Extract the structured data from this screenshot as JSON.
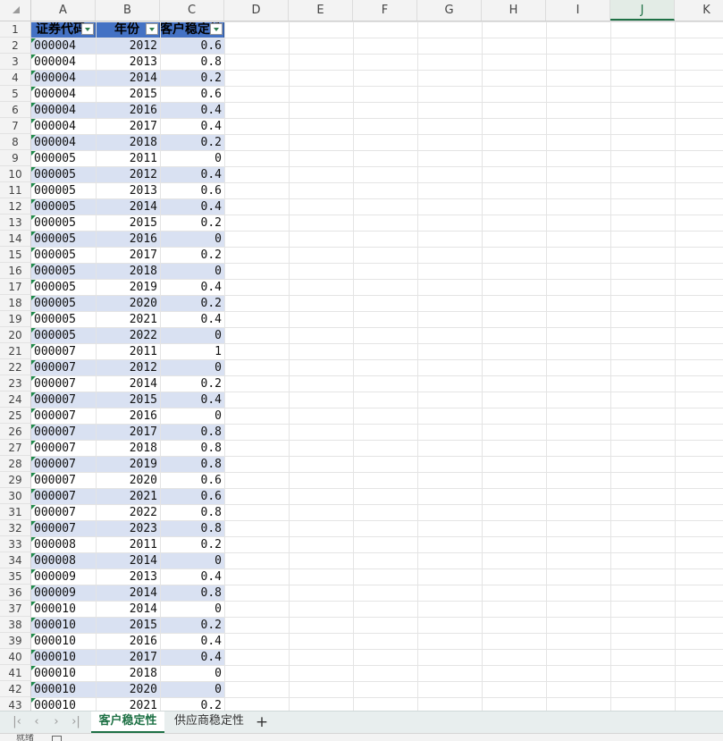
{
  "columns": [
    "A",
    "B",
    "C",
    "D",
    "E",
    "F",
    "G",
    "H",
    "I",
    "J",
    "K"
  ],
  "selected_column": "J",
  "rows": [
    "1",
    "2",
    "3",
    "4",
    "5",
    "6",
    "7",
    "8",
    "9",
    "10",
    "11",
    "12",
    "13",
    "14",
    "15",
    "16",
    "17",
    "18",
    "19",
    "20",
    "21",
    "22",
    "23",
    "24",
    "25",
    "26",
    "27",
    "28",
    "29",
    "30",
    "31",
    "32",
    "33",
    "34",
    "35",
    "36",
    "37",
    "38",
    "39",
    "40",
    "41",
    "42",
    "43"
  ],
  "table_headers": [
    "证券代码",
    "年份",
    "客户稳定性"
  ],
  "table_rows": [
    {
      "code": "000004",
      "year": "2012",
      "value": "0.6"
    },
    {
      "code": "000004",
      "year": "2013",
      "value": "0.8"
    },
    {
      "code": "000004",
      "year": "2014",
      "value": "0.2"
    },
    {
      "code": "000004",
      "year": "2015",
      "value": "0.6"
    },
    {
      "code": "000004",
      "year": "2016",
      "value": "0.4"
    },
    {
      "code": "000004",
      "year": "2017",
      "value": "0.4"
    },
    {
      "code": "000004",
      "year": "2018",
      "value": "0.2"
    },
    {
      "code": "000005",
      "year": "2011",
      "value": "0"
    },
    {
      "code": "000005",
      "year": "2012",
      "value": "0.4"
    },
    {
      "code": "000005",
      "year": "2013",
      "value": "0.6"
    },
    {
      "code": "000005",
      "year": "2014",
      "value": "0.4"
    },
    {
      "code": "000005",
      "year": "2015",
      "value": "0.2"
    },
    {
      "code": "000005",
      "year": "2016",
      "value": "0"
    },
    {
      "code": "000005",
      "year": "2017",
      "value": "0.2"
    },
    {
      "code": "000005",
      "year": "2018",
      "value": "0"
    },
    {
      "code": "000005",
      "year": "2019",
      "value": "0.4"
    },
    {
      "code": "000005",
      "year": "2020",
      "value": "0.2"
    },
    {
      "code": "000005",
      "year": "2021",
      "value": "0.4"
    },
    {
      "code": "000005",
      "year": "2022",
      "value": "0"
    },
    {
      "code": "000007",
      "year": "2011",
      "value": "1"
    },
    {
      "code": "000007",
      "year": "2012",
      "value": "0"
    },
    {
      "code": "000007",
      "year": "2014",
      "value": "0.2"
    },
    {
      "code": "000007",
      "year": "2015",
      "value": "0.4"
    },
    {
      "code": "000007",
      "year": "2016",
      "value": "0"
    },
    {
      "code": "000007",
      "year": "2017",
      "value": "0.8"
    },
    {
      "code": "000007",
      "year": "2018",
      "value": "0.8"
    },
    {
      "code": "000007",
      "year": "2019",
      "value": "0.8"
    },
    {
      "code": "000007",
      "year": "2020",
      "value": "0.6"
    },
    {
      "code": "000007",
      "year": "2021",
      "value": "0.6"
    },
    {
      "code": "000007",
      "year": "2022",
      "value": "0.8"
    },
    {
      "code": "000007",
      "year": "2023",
      "value": "0.8"
    },
    {
      "code": "000008",
      "year": "2011",
      "value": "0.2"
    },
    {
      "code": "000008",
      "year": "2014",
      "value": "0"
    },
    {
      "code": "000009",
      "year": "2013",
      "value": "0.4"
    },
    {
      "code": "000009",
      "year": "2014",
      "value": "0.8"
    },
    {
      "code": "000010",
      "year": "2014",
      "value": "0"
    },
    {
      "code": "000010",
      "year": "2015",
      "value": "0.2"
    },
    {
      "code": "000010",
      "year": "2016",
      "value": "0.4"
    },
    {
      "code": "000010",
      "year": "2017",
      "value": "0.4"
    },
    {
      "code": "000010",
      "year": "2018",
      "value": "0"
    },
    {
      "code": "000010",
      "year": "2020",
      "value": "0"
    },
    {
      "code": "000010",
      "year": "2021",
      "value": "0.2"
    }
  ],
  "colors": {
    "header_fill": "#4472c4",
    "band_fill": "#d9e1f2",
    "accent": "#1e7145",
    "error_triangle": "#1e8a4a"
  },
  "sheet_tabs": [
    {
      "label": "客户稳定性",
      "active": true
    },
    {
      "label": "供应商稳定性",
      "active": false
    }
  ],
  "tab_nav": {
    "first": "first-sheet-icon",
    "prev": "prev-sheet-icon",
    "next": "next-sheet-icon",
    "last": "last-sheet-icon"
  },
  "add_tab": "+",
  "status": {
    "text": "就绪"
  }
}
